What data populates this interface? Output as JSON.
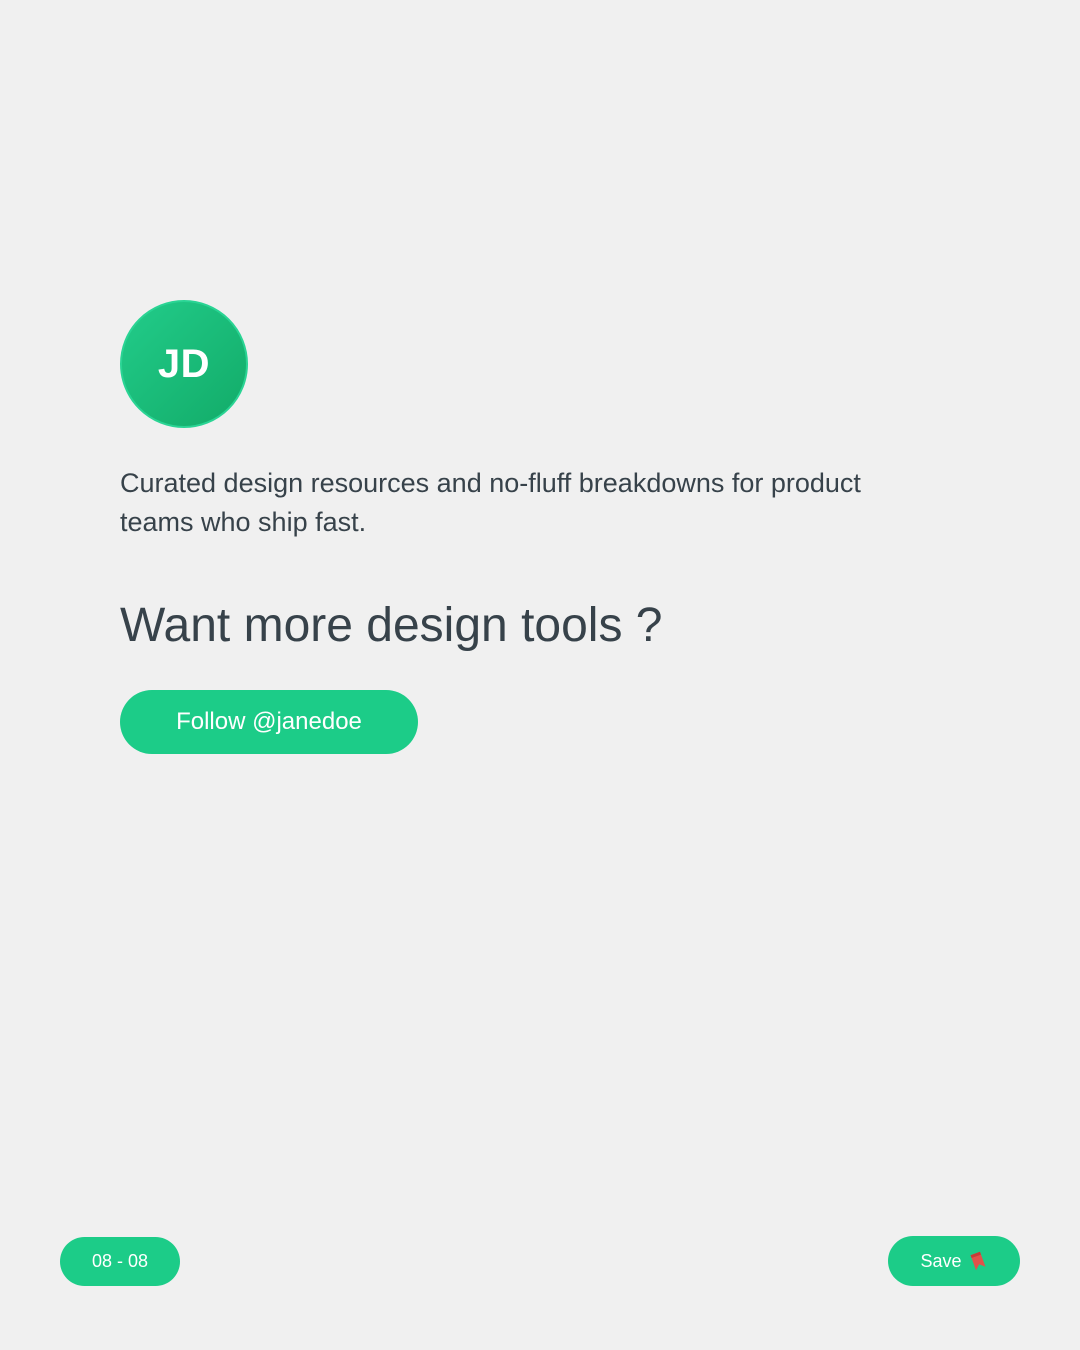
{
  "profile": {
    "initials": "JD",
    "bio": "Curated design resources and no-fluff breakdowns for product teams who ship fast."
  },
  "cta": {
    "heading": "Want more design tools ?",
    "follow_label": "Follow @janedoe"
  },
  "footer": {
    "page_indicator": "08 - 08",
    "save_label": "Save",
    "save_icon": "bookmark-icon"
  },
  "colors": {
    "background": "#f0f0f0",
    "accent": "#1ccc88",
    "text": "#37424a",
    "bookmark": "#e0524a"
  }
}
